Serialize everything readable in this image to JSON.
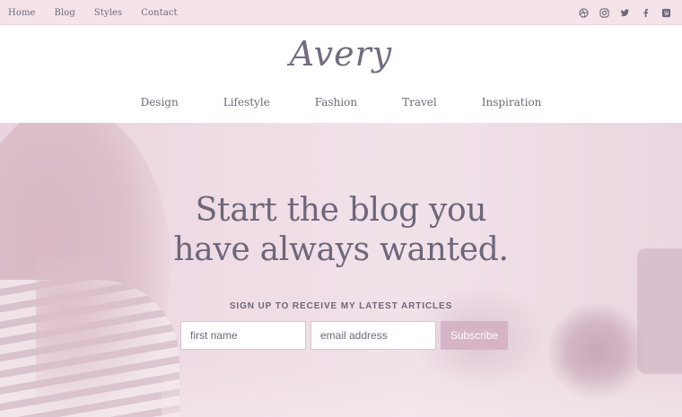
{
  "topbar": {
    "links": [
      "Home",
      "Blog",
      "Styles",
      "Contact"
    ],
    "social_icons": [
      "dribbble-icon",
      "instagram-icon",
      "twitter-icon",
      "facebook-icon",
      "pinterest-icon"
    ]
  },
  "header": {
    "logo": "Avery",
    "nav": [
      "Design",
      "Lifestyle",
      "Fashion",
      "Travel",
      "Inspiration"
    ]
  },
  "hero": {
    "title_line1": "Start the blog you",
    "title_line2": "have always wanted.",
    "signup_label": "SIGN UP TO RECEIVE MY LATEST ARTICLES",
    "first_name_placeholder": "first name",
    "email_placeholder": "email address",
    "subscribe_label": "Subscribe"
  },
  "colors": {
    "topbar_bg": "#f4e4ea",
    "text": "#6d6779",
    "button": "#d7b3c6",
    "hero_tint": "#efdce5"
  }
}
